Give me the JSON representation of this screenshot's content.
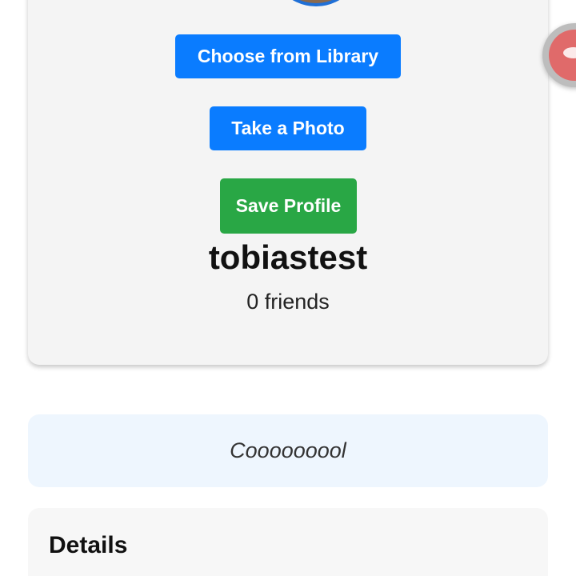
{
  "profile": {
    "choose_library_label": "Choose from Library",
    "take_photo_label": "Take a Photo",
    "save_profile_label": "Save Profile",
    "username": "tobiastest",
    "friends_text": "0 friends"
  },
  "bio": {
    "text": "Cooooooool"
  },
  "details": {
    "title": "Details"
  },
  "colors": {
    "primary_blue": "#0a7cff",
    "save_green": "#29a745",
    "card_gray": "#f4f4f4",
    "bio_background": "#eef6fe"
  }
}
